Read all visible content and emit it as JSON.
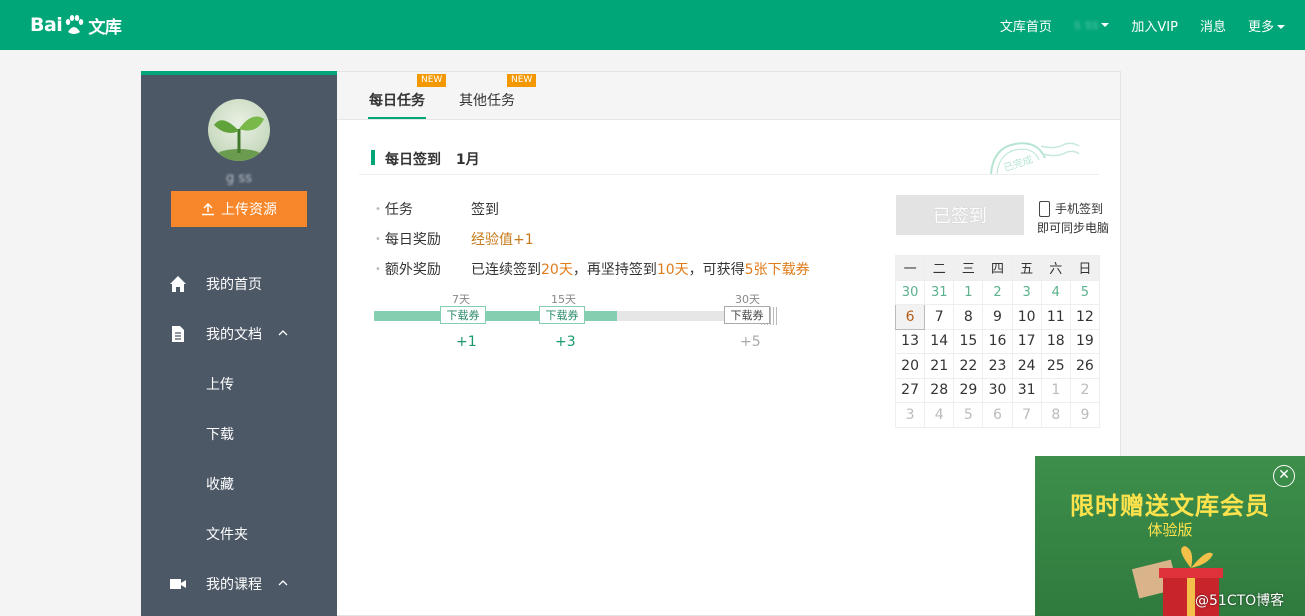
{
  "header": {
    "logo_text_a": "Bai",
    "logo_text_b": "文库",
    "nav": {
      "home": "文库首页",
      "user": "s      ss",
      "vip": "加入VIP",
      "messages": "消息",
      "more": "更多"
    }
  },
  "sidebar": {
    "username": "g     ss",
    "upload_label": "上传资源",
    "items": [
      {
        "label": "我的首页"
      },
      {
        "label": "我的文档"
      },
      {
        "label": "上传"
      },
      {
        "label": "下载"
      },
      {
        "label": "收藏"
      },
      {
        "label": "文件夹"
      },
      {
        "label": "我的课程"
      }
    ]
  },
  "tabs": [
    {
      "label": "每日任务",
      "badge": "NEW"
    },
    {
      "label": "其他任务",
      "badge": "NEW"
    }
  ],
  "section": {
    "title": "每日签到",
    "month": "1月",
    "stamp_text": "已完成"
  },
  "task": {
    "rows": [
      {
        "key": "任务",
        "value": "签到"
      },
      {
        "key": "每日奖励",
        "value": "经验值+1"
      },
      {
        "key": "额外奖励",
        "value_a": "已连续签到",
        "value_b": "20天",
        "value_c": "，再坚持签到",
        "value_d": "10天",
        "value_e": "，可获得",
        "value_f": "5张下载券"
      }
    ]
  },
  "progress": {
    "current_days": 20,
    "max_days": 30,
    "milestones": [
      {
        "day_label": "7天",
        "coupon_label": "下载券",
        "reward": "+1",
        "done": true
      },
      {
        "day_label": "15天",
        "coupon_label": "下载券",
        "reward": "+3",
        "done": true
      },
      {
        "day_label": "30天",
        "coupon_label": "下载券",
        "reward": "+5",
        "done": false
      }
    ]
  },
  "signin": {
    "button_label": "已签到",
    "phone_line1": "手机签到",
    "phone_line2": "即可同步电脑"
  },
  "calendar": {
    "weekdays": [
      "一",
      "二",
      "三",
      "四",
      "五",
      "六",
      "日"
    ],
    "rows": [
      [
        "30",
        "31",
        "1",
        "2",
        "3",
        "4",
        "5"
      ],
      [
        "6",
        "7",
        "8",
        "9",
        "10",
        "11",
        "12"
      ],
      [
        "13",
        "14",
        "15",
        "16",
        "17",
        "18",
        "19"
      ],
      [
        "20",
        "21",
        "22",
        "23",
        "24",
        "25",
        "26"
      ],
      [
        "27",
        "28",
        "29",
        "30",
        "31",
        "1",
        "2"
      ],
      [
        "3",
        "4",
        "5",
        "6",
        "7",
        "8",
        "9"
      ]
    ],
    "today": "6"
  },
  "promo": {
    "title": "限时赠送文库会员",
    "subtitle": "体验版",
    "close": "✕"
  },
  "watermark": "@51CTO博客",
  "colors": {
    "brand": "#00a677",
    "sidebar": "#4d5866",
    "upload": "#f8862a",
    "badge": "#f39800"
  }
}
